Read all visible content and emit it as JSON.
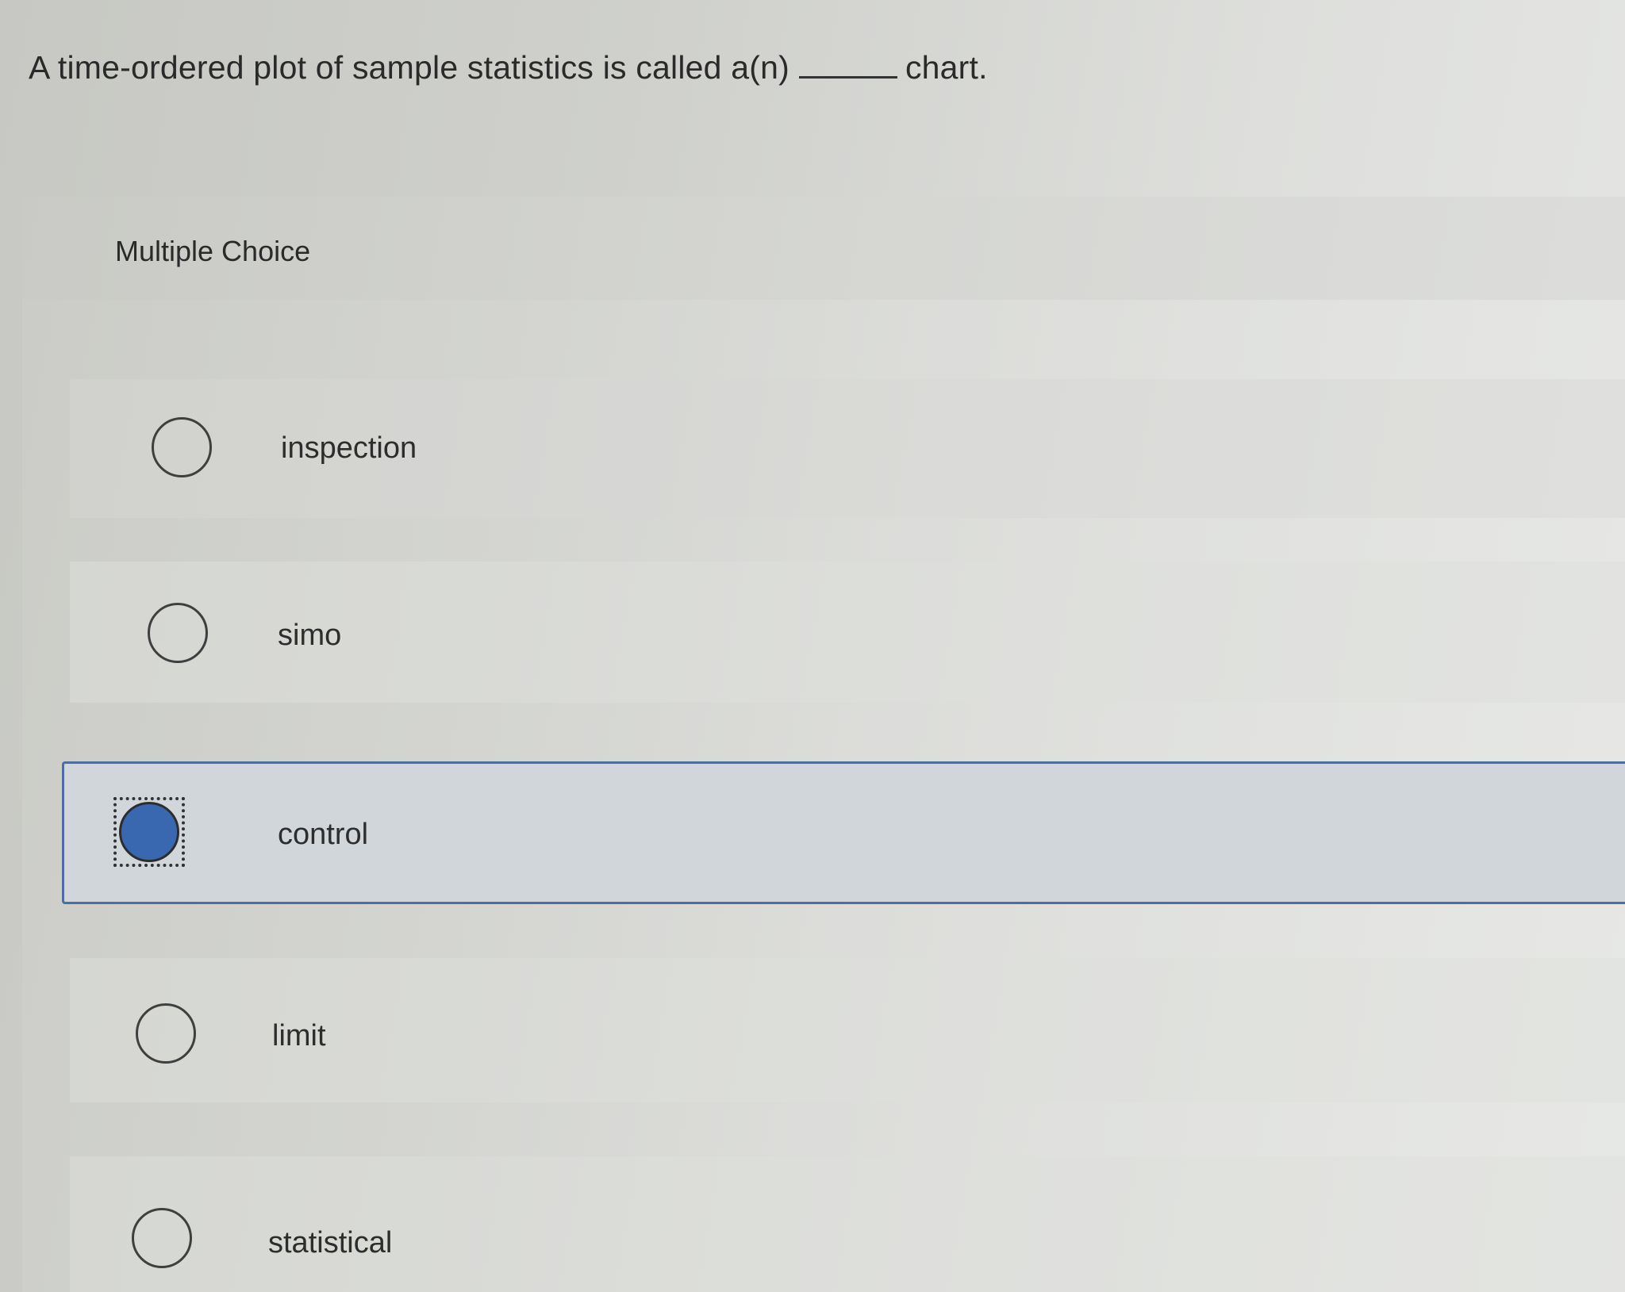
{
  "question": {
    "prefix": "A time-ordered plot of sample statistics is called a(n)",
    "suffix": "chart."
  },
  "section_label": "Multiple Choice",
  "options": [
    {
      "label": "inspection",
      "selected": false
    },
    {
      "label": "simo",
      "selected": false
    },
    {
      "label": "control",
      "selected": true
    },
    {
      "label": "limit",
      "selected": false
    },
    {
      "label": "statistical",
      "selected": false
    }
  ],
  "colors": {
    "selected_fill": "#3a68b0",
    "selected_border": "#4a6fa5",
    "selected_background": "#d1d6da"
  }
}
